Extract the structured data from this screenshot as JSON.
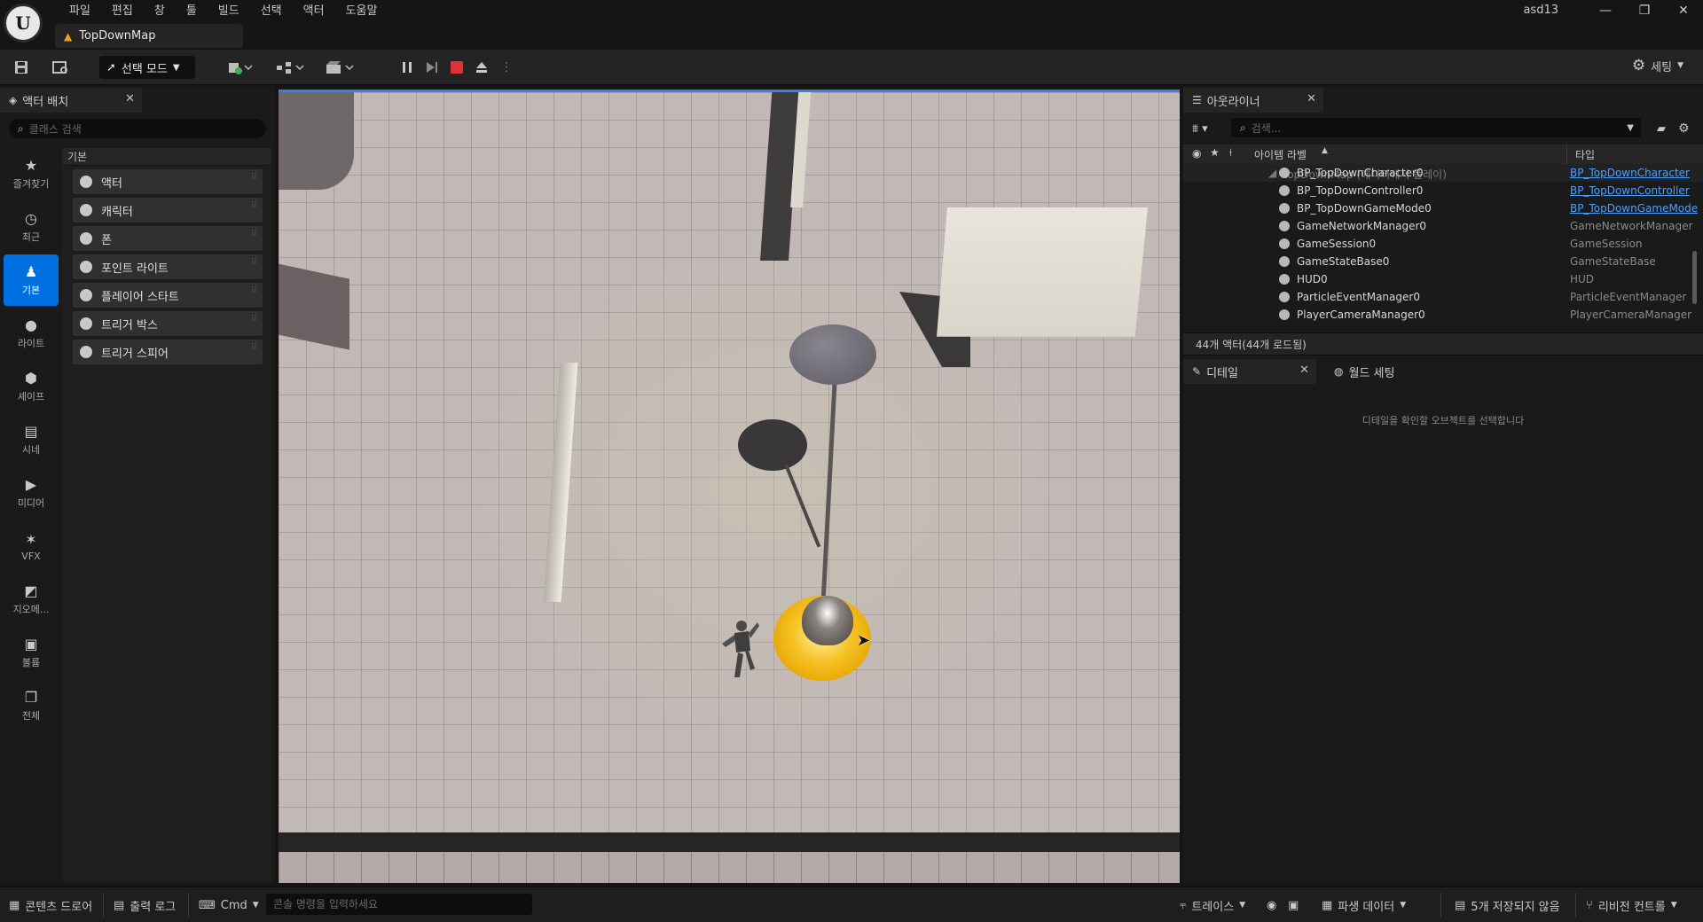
{
  "menu": [
    "파일",
    "편집",
    "창",
    "툴",
    "빌드",
    "선택",
    "액터",
    "도움말"
  ],
  "document_tab": "TopDownMap",
  "user": "asd13",
  "window_buttons": [
    "—",
    "❐",
    "✕"
  ],
  "toolbar": {
    "mode_label": "선택 모드",
    "settings_label": "세팅"
  },
  "placement": {
    "tab_title": "액터 배치",
    "search_placeholder": "클래스 검색",
    "header": "기본",
    "categories": [
      "즐겨찾기",
      "최근",
      "기본",
      "라이트",
      "셰이프",
      "시네",
      "미디어",
      "VFX",
      "지오메...",
      "볼륨",
      "전체"
    ],
    "items": [
      "액터",
      "캐릭터",
      "폰",
      "포인트 라이트",
      "플레이어 스타트",
      "트리거 박스",
      "트리거 스피어"
    ]
  },
  "outliner": {
    "tab_title": "아웃라이너",
    "search_placeholder": "검색...",
    "col_label": "아이템 라벨",
    "col_type": "타입",
    "root": "TopDownMap (에디터에서 플레이)",
    "rows": [
      {
        "name": "BP_TopDownCharacter0",
        "type": "BP_TopDownCharacter",
        "link": true
      },
      {
        "name": "BP_TopDownController0",
        "type": "BP_TopDownController",
        "link": true
      },
      {
        "name": "BP_TopDownGameMode0",
        "type": "BP_TopDownGameMode",
        "link": true
      },
      {
        "name": "GameNetworkManager0",
        "type": "GameNetworkManager",
        "link": false
      },
      {
        "name": "GameSession0",
        "type": "GameSession",
        "link": false
      },
      {
        "name": "GameStateBase0",
        "type": "GameStateBase",
        "link": false
      },
      {
        "name": "HUD0",
        "type": "HUD",
        "link": false
      },
      {
        "name": "ParticleEventManager0",
        "type": "ParticleEventManager",
        "link": false
      },
      {
        "name": "PlayerCameraManager0",
        "type": "PlayerCameraManager",
        "link": false
      }
    ],
    "footer": "44개 액터(44개 로드됨)"
  },
  "details": {
    "tab_title": "디테일",
    "world_tab": "월드 세팅",
    "hint": "디테일을 확인할 오브젝트를 선택합니다"
  },
  "statusbar": {
    "content_drawer": "콘텐츠 드로어",
    "output_log": "출력 로그",
    "cmd": "Cmd",
    "console_placeholder": "콘솔 명령을 입력하세요",
    "trace": "트레이스",
    "derived_data": "파생 데이터",
    "unsaved": "5개 저장되지 않음",
    "revision": "리비전 컨트롤"
  }
}
